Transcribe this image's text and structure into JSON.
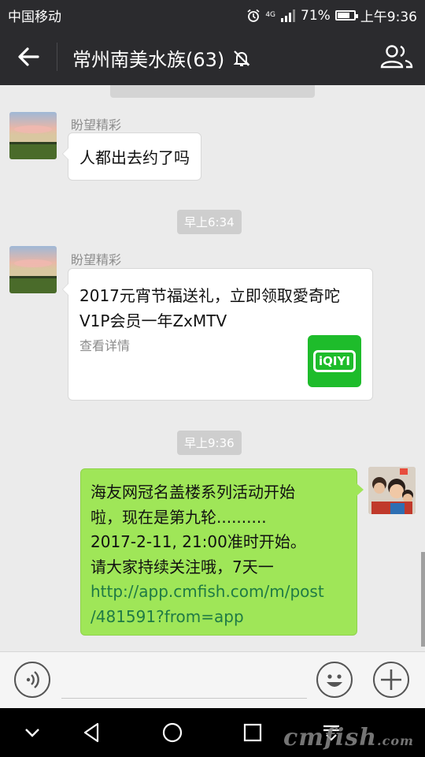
{
  "status_bar": {
    "carrier": "中国移动",
    "network": "4G",
    "battery_percent": "71%",
    "battery_level": 0.71,
    "time": "上午9:36"
  },
  "header": {
    "title": "常州南美水族(63)",
    "back_icon": "back-arrow-icon",
    "mute_icon": "mute-bell-icon",
    "members_icon": "group-members-icon"
  },
  "messages": [
    {
      "type": "text",
      "side": "left",
      "sender": "盼望精彩",
      "text": "人都出去约了吗"
    },
    {
      "type": "time",
      "text": "早上6:34"
    },
    {
      "type": "card",
      "side": "left",
      "sender": "盼望精彩",
      "title": "2017元宵节福送礼，立即领取愛奇咜V1P会员一年ZxMTV",
      "link_label": "查看详情",
      "thumb_text": "iQIYI",
      "thumb_color": "#1ebc2b"
    },
    {
      "type": "time",
      "text": "早上9:36"
    },
    {
      "type": "text",
      "side": "right",
      "lines": [
        "海友网冠名盖楼系列活动开始",
        "啦，现在是第九轮..........",
        "2017-2-11, 21:00准时开始。",
        "请大家持续关注哦，7天一"
      ],
      "link_lines": [
        "http://app.cmfish.com/m/post",
        "/481591?from=app"
      ],
      "link_color": "#1f7a45"
    }
  ],
  "input_bar": {
    "voice_icon": "voice-icon",
    "emoji_icon": "emoji-icon",
    "plus_icon": "plus-icon"
  },
  "nav_bar": {
    "icons": [
      "collapse-icon",
      "back-triangle-icon",
      "home-circle-icon",
      "recents-square-icon",
      "notification-pull-icon"
    ]
  },
  "watermark": {
    "main": "cmfish",
    "suffix": ".com"
  },
  "colors": {
    "header_bg": "#2b2b2e",
    "chat_bg": "#ebebeb",
    "sent_bubble": "#9fe658"
  }
}
